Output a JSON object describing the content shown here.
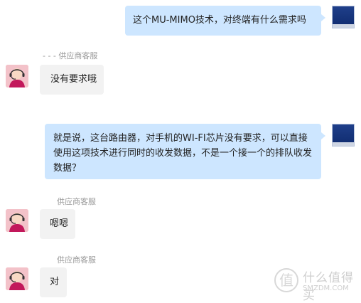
{
  "messages": [
    {
      "side": "right",
      "text": "这个MU-MIMO技术，对终端有什么需求吗"
    },
    {
      "side": "left",
      "sender": "- - - 供应商客服",
      "text": "没有要求哦"
    },
    {
      "side": "right",
      "text": "就是说，这台路由器，对手机的WI-FI芯片没有要求，可以直接使用这项技术进行同时的收发数据，不是一个接一个的排队收发数据？"
    },
    {
      "side": "left",
      "sender": "供应商客服",
      "text": "嗯嗯"
    },
    {
      "side": "left",
      "sender": "供应商客服",
      "text": "对"
    }
  ],
  "watermark": {
    "icon": "值",
    "line1": "什么值得买",
    "line2": "SMZDM.COM"
  }
}
